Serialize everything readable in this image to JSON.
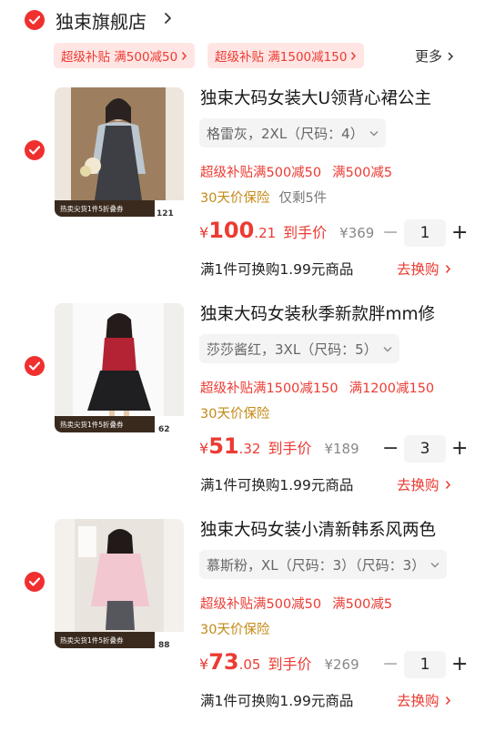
{
  "store": {
    "name": "独束旗舰店",
    "coupons": [
      "超级补贴 满500减50",
      "超级补贴 满1500减150"
    ],
    "more_label": "更多"
  },
  "items": [
    {
      "title": "独束大码女装大U领背心裙公主",
      "sku": "格雷灰，2XL（尺码：4）",
      "promos": [
        "超级补贴满500减50",
        "满500减5"
      ],
      "guarantee": "30天价保险",
      "stock_note": "仅剩5件",
      "price_currency": "¥",
      "price_int": "100",
      "price_dec": ".21",
      "price_label": "到手价",
      "orig_price": "¥369",
      "qty": "1",
      "qty_minus": "−",
      "qty_plus": "+",
      "swap_text": "满1件可换购1.99元商品",
      "swap_link": "去换购",
      "thumb_banner": "热卖尖货1件5折叠券",
      "thumb_badge": "121"
    },
    {
      "title": "独束大码女装秋季新款胖mm修",
      "sku": "莎莎酱红，3XL（尺码：5）",
      "promos": [
        "超级补贴满1500减150",
        "满1200减150"
      ],
      "guarantee": "30天价保险",
      "stock_note": "",
      "price_currency": "¥",
      "price_int": "51",
      "price_dec": ".32",
      "price_label": "到手价",
      "orig_price": "¥189",
      "qty": "3",
      "qty_minus": "−",
      "qty_plus": "+",
      "swap_text": "满1件可换购1.99元商品",
      "swap_link": "去换购",
      "thumb_banner": "热卖尖货1件5折叠券",
      "thumb_badge": "62"
    },
    {
      "title": "独束大码女装小清新韩系风两色",
      "sku": "慕斯粉，XL（尺码：3）（尺码：3）",
      "promos": [
        "超级补贴满500减50",
        "满500减5"
      ],
      "guarantee": "30天价保险",
      "stock_note": "",
      "price_currency": "¥",
      "price_int": "73",
      "price_dec": ".05",
      "price_label": "到手价",
      "orig_price": "¥269",
      "qty": "1",
      "qty_minus": "−",
      "qty_plus": "+",
      "swap_text": "满1件可换购1.99元商品",
      "swap_link": "去换购",
      "thumb_banner": "热卖尖货1件5折叠券",
      "thumb_badge": "88"
    }
  ],
  "icons": {
    "checkbox": "checked-circle-icon",
    "chevron": "chevron-right-icon",
    "dropdown": "chevron-down-icon"
  },
  "colors": {
    "accent": "#ec3b33",
    "check": "#f02f2f",
    "guarantee": "#c48a16",
    "coupon_bg": "#ffe6e4"
  }
}
